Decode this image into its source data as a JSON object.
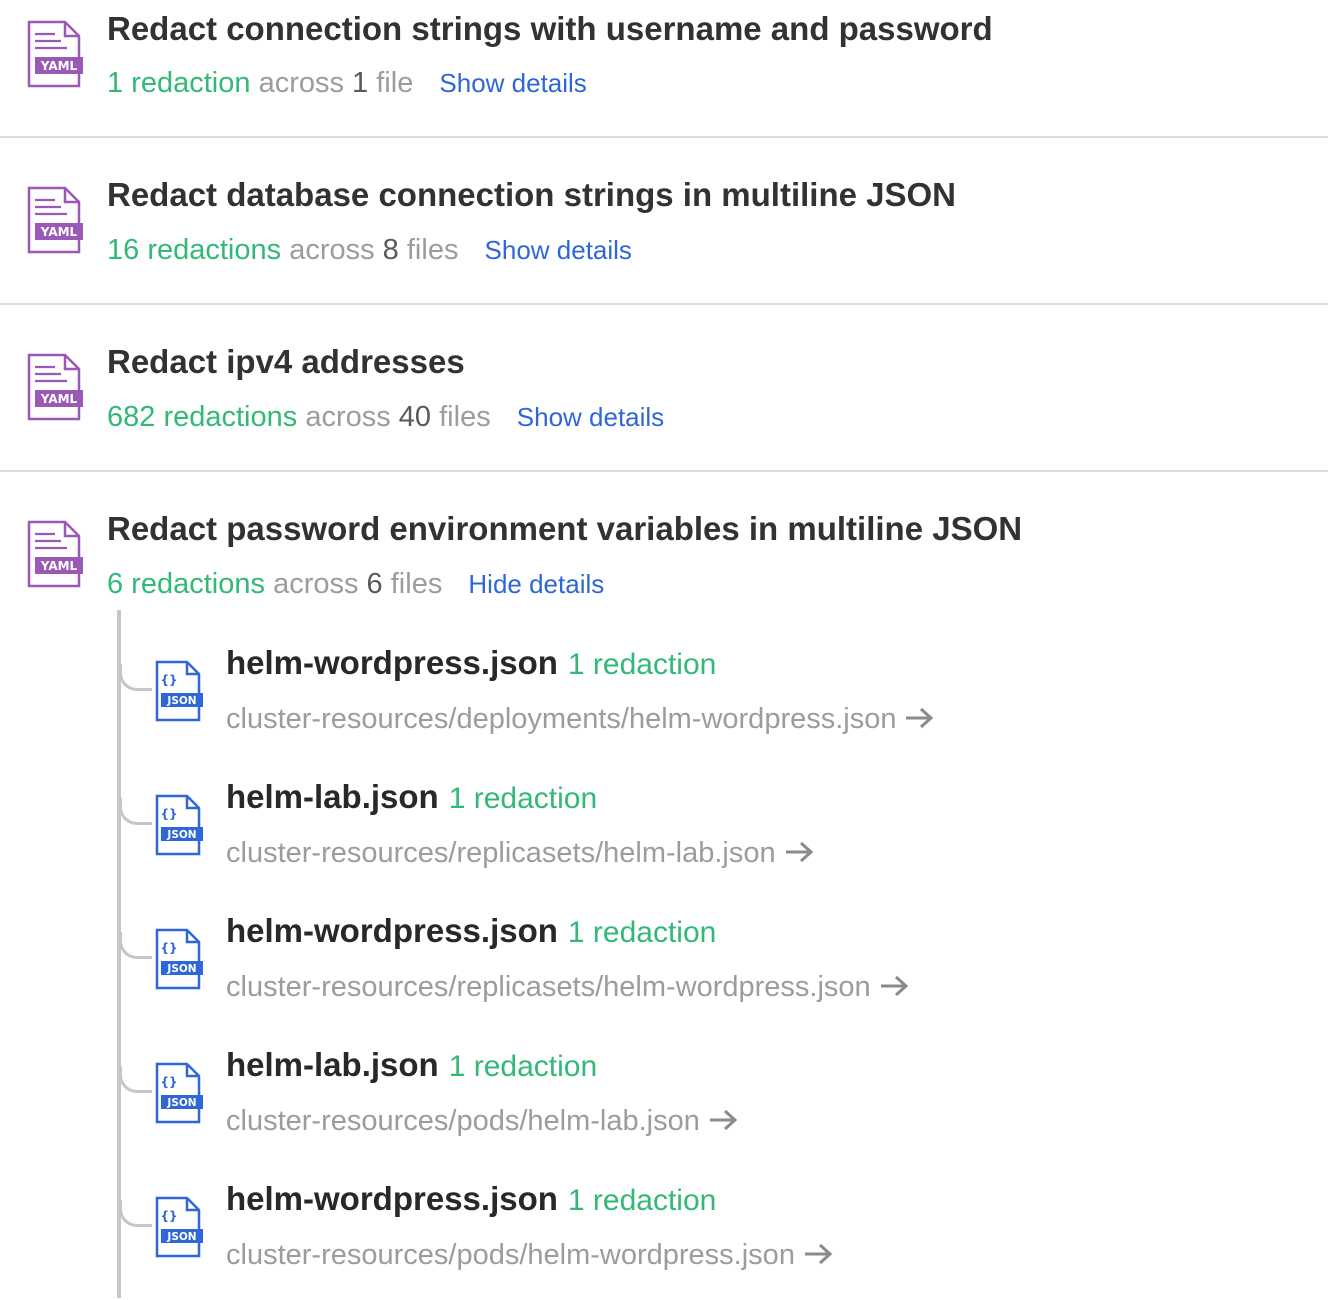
{
  "labels": {
    "across": "across"
  },
  "colors": {
    "redaction_green": "#33b977",
    "link_blue": "#2f66d8",
    "yaml_purple": "#9b59b6",
    "json_blue": "#2f66d8"
  },
  "rules": [
    {
      "title": "Redact connection strings with username and password",
      "redactions": "1 redaction",
      "file_count": "1",
      "file_word": "file",
      "toggle": "Show details",
      "icon": "yaml-file-icon",
      "icon_label": "YAML"
    },
    {
      "title": "Redact database connection strings in multiline JSON",
      "redactions": "16 redactions",
      "file_count": "8",
      "file_word": "files",
      "toggle": "Show details",
      "icon": "yaml-file-icon",
      "icon_label": "YAML"
    },
    {
      "title": "Redact ipv4 addresses",
      "redactions": "682 redactions",
      "file_count": "40",
      "file_word": "files",
      "toggle": "Show details",
      "icon": "yaml-file-icon",
      "icon_label": "YAML"
    },
    {
      "title": "Redact password environment variables in multiline JSON",
      "redactions": "6 redactions",
      "file_count": "6",
      "file_word": "files",
      "toggle": "Hide details",
      "icon": "yaml-file-icon",
      "icon_label": "YAML",
      "files": [
        {
          "name": "helm-wordpress.json",
          "count": "1 redaction",
          "path": "cluster-resources/deployments/helm-wordpress.json",
          "icon": "json-file-icon",
          "icon_label": "JSON",
          "icon_glyph": "{}"
        },
        {
          "name": "helm-lab.json",
          "count": "1 redaction",
          "path": "cluster-resources/replicasets/helm-lab.json",
          "icon": "json-file-icon",
          "icon_label": "JSON",
          "icon_glyph": "{}"
        },
        {
          "name": "helm-wordpress.json",
          "count": "1 redaction",
          "path": "cluster-resources/replicasets/helm-wordpress.json",
          "icon": "json-file-icon",
          "icon_label": "JSON",
          "icon_glyph": "{}"
        },
        {
          "name": "helm-lab.json",
          "count": "1 redaction",
          "path": "cluster-resources/pods/helm-lab.json",
          "icon": "json-file-icon",
          "icon_label": "JSON",
          "icon_glyph": "{}"
        },
        {
          "name": "helm-wordpress.json",
          "count": "1 redaction",
          "path": "cluster-resources/pods/helm-wordpress.json",
          "icon": "json-file-icon",
          "icon_label": "JSON",
          "icon_glyph": "{}"
        }
      ]
    }
  ]
}
